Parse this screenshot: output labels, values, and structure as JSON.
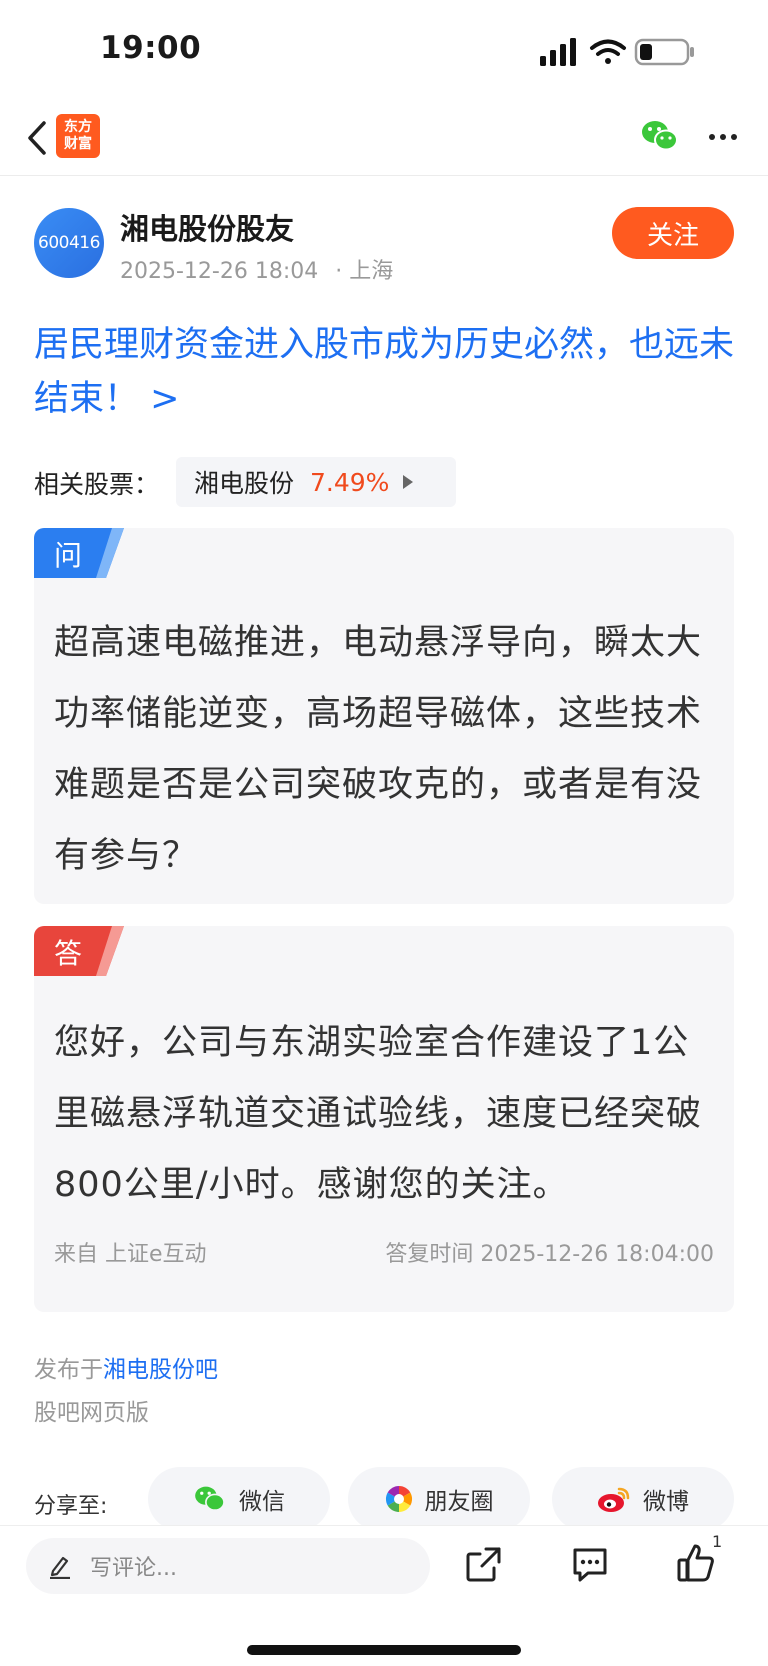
{
  "status": {
    "time": "19:00"
  },
  "nav": {
    "logo_line1": "东方",
    "logo_line2": "财富"
  },
  "author": {
    "avatar_text": "600416",
    "name": "湘电股份股友",
    "datetime": "2025-12-26 18:04",
    "location": "· 上海",
    "follow_label": "关注"
  },
  "post": {
    "title": "居民理财资金进入股市成为历史必然，也远未结束！ >"
  },
  "related": {
    "label": "相关股票：",
    "stock_name": "湘电股份",
    "stock_change": "7.49%"
  },
  "question": {
    "tag": "问",
    "text": "超高速电磁推进，电动悬浮导向，瞬太大功率储能逆变，高场超导磁体，这些技术难题是否是公司突破攻克的，或者是有没有参与？"
  },
  "answer": {
    "tag": "答",
    "text": "您好，公司与东湖实验室合作建设了1公里磁悬浮轨道交通试验线，速度已经突破800公里/小时。感谢您的关注。",
    "source": "来自 上证e互动",
    "reply_time": "答复时间 2025-12-26 18:04:00"
  },
  "footer": {
    "published_prefix": "发布于",
    "published_bar": "湘电股份吧",
    "web_version": "股吧网页版"
  },
  "share": {
    "label": "分享至:",
    "wechat": "微信",
    "moments": "朋友圈",
    "weibo": "微博"
  },
  "bottom": {
    "comment_placeholder": "写评论...",
    "like_count": "1"
  },
  "colors": {
    "brand_orange": "#ff5a1f",
    "link_blue": "#1d6ff2",
    "rise_red": "#f04a1d",
    "question_tag": "#2b7ef0",
    "answer_tag": "#e8453c"
  }
}
